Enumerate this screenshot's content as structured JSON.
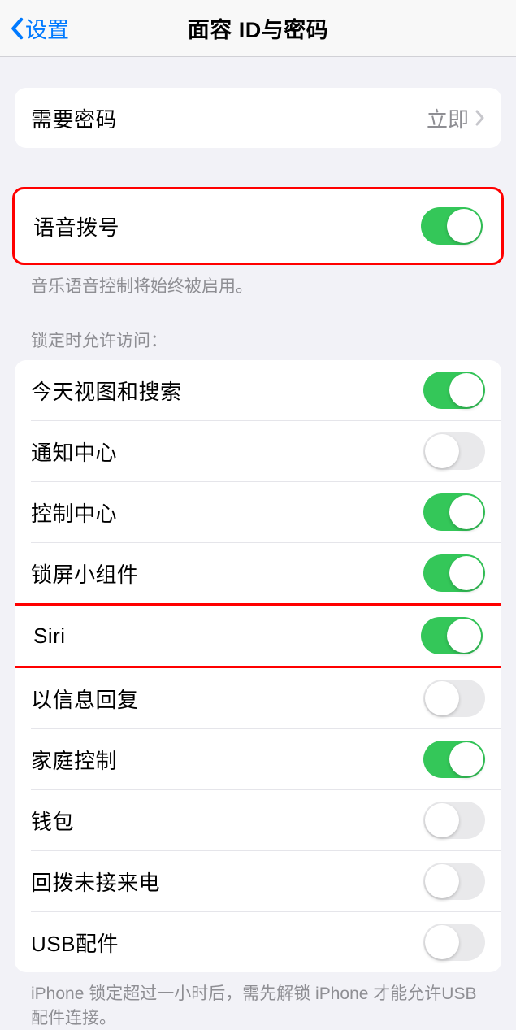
{
  "header": {
    "back_label": "设置",
    "title": "面容 ID与密码"
  },
  "passcode_section": {
    "require_passcode": {
      "label": "需要密码",
      "value": "立即"
    }
  },
  "voice_dial": {
    "label": "语音拨号",
    "enabled": true,
    "footer": "音乐语音控制将始终被启用。"
  },
  "lock_screen_access": {
    "header": "锁定时允许访问：",
    "items": [
      {
        "label": "今天视图和搜索",
        "enabled": true
      },
      {
        "label": "通知中心",
        "enabled": false
      },
      {
        "label": "控制中心",
        "enabled": true
      },
      {
        "label": "锁屏小组件",
        "enabled": true
      },
      {
        "label": "Siri",
        "enabled": true,
        "highlighted": true
      },
      {
        "label": "以信息回复",
        "enabled": false
      },
      {
        "label": "家庭控制",
        "enabled": true
      },
      {
        "label": "钱包",
        "enabled": false
      },
      {
        "label": "回拨未接来电",
        "enabled": false
      },
      {
        "label": "USB配件",
        "enabled": false
      }
    ],
    "footer": "iPhone 锁定超过一小时后，需先解锁 iPhone 才能允许USB 配件连接。"
  }
}
